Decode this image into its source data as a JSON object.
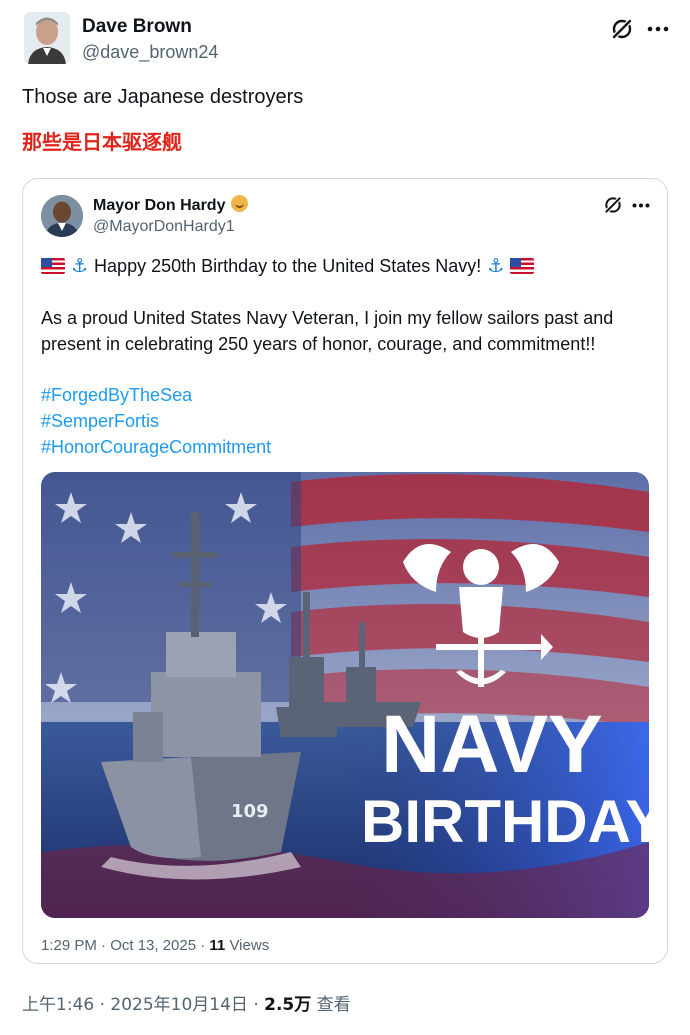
{
  "author": {
    "name": "Dave Brown",
    "handle": "@dave_brown24"
  },
  "tweet": {
    "text": "Those are Japanese destroyers",
    "translation": "那些是日本驱逐舰"
  },
  "quote": {
    "name": "Mayor Don Hardy",
    "handle": "@MayorDonHardy1",
    "line1": "Happy 250th Birthday to the United States Navy!",
    "paragraph": "As a proud United States Navy Veteran, I join my fellow sailors past and present in celebrating 250 years of honor, courage, and commitment!!",
    "hashtags": [
      "#ForgedByTheSea",
      "#SemperFortis",
      "#HonorCourageCommitment"
    ],
    "image": {
      "title_1": "NAVY",
      "title_2": "BIRTHDAY",
      "hull_number": "109"
    },
    "timestamp": "1:29 PM · Oct 13, 2025 · ",
    "views_count": "11",
    "views_label": " Views"
  },
  "footer": {
    "timestamp": "上午1:46 · 2025年10月14日 · ",
    "views_count": "2.5万",
    "views_label": " 查看"
  },
  "icons": {
    "grok": "grok-icon",
    "more": "more-icon",
    "flag": "us-flag-icon",
    "anchor": "anchor-icon"
  },
  "colors": {
    "link": "#1d9bf0",
    "translation": "#e2231a",
    "muted": "#536471"
  }
}
